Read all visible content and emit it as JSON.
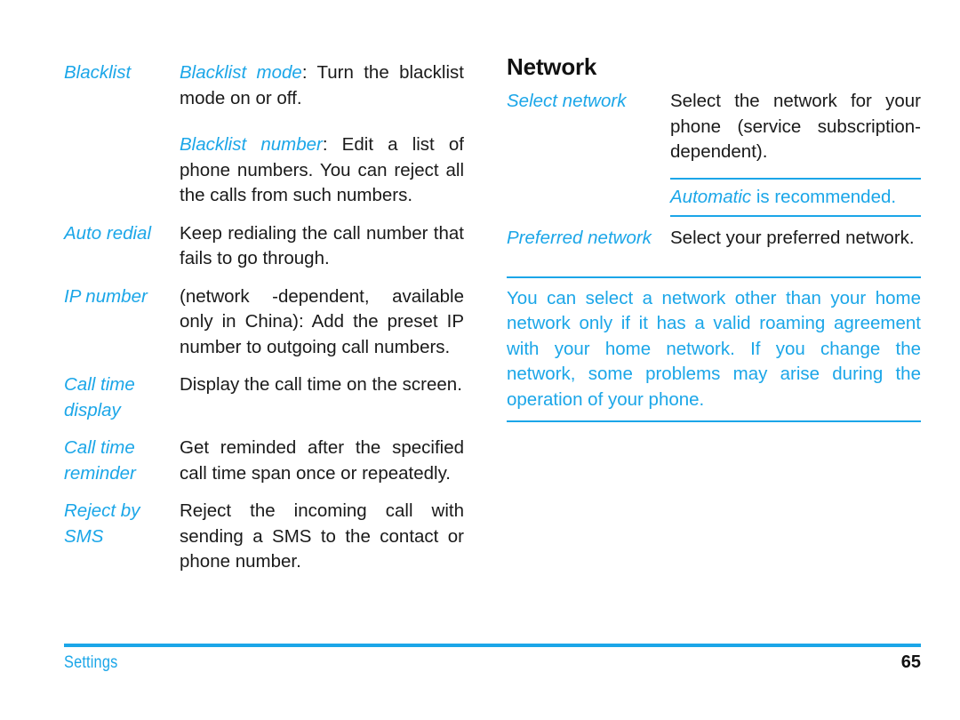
{
  "page": {
    "section_name": "Settings",
    "page_number": "65",
    "accent_color": "#1ba6e8"
  },
  "left_column": {
    "rows": [
      {
        "label": "Blacklist",
        "paragraphs": [
          {
            "term": "Blacklist mode",
            "rest": ": Turn the blacklist mode on or off."
          },
          {
            "term": "Blacklist number",
            "rest": ": Edit a list of phone numbers. You can reject all the calls from such numbers."
          }
        ]
      },
      {
        "label": "Auto redial",
        "paragraphs": [
          {
            "term": "",
            "rest": "Keep redialing the call number that fails to go through."
          }
        ]
      },
      {
        "label": "IP number",
        "paragraphs": [
          {
            "term": "",
            "rest": "(network -dependent, available only in China): Add the preset IP number to outgoing call numbers."
          }
        ]
      },
      {
        "label": "Call time display",
        "paragraphs": [
          {
            "term": "",
            "rest": "Display the call time on the screen."
          }
        ]
      },
      {
        "label": "Call time reminder",
        "paragraphs": [
          {
            "term": "",
            "rest": "Get reminded after the specified call time span once or repeatedly."
          }
        ]
      },
      {
        "label": "Reject by SMS",
        "paragraphs": [
          {
            "term": "",
            "rest": "Reject the incoming call with sending a SMS to the contact or phone number."
          }
        ]
      }
    ]
  },
  "right_column": {
    "heading": "Network",
    "rows": [
      {
        "label": "Select network",
        "paragraphs": [
          {
            "term": "",
            "rest": "Select the network for your phone (service subscription-dependent)."
          }
        ]
      }
    ],
    "note_recommended": {
      "term": "Automatic",
      "rest": " is recommended."
    },
    "rows2": [
      {
        "label": "Preferred network",
        "paragraphs": [
          {
            "term": "",
            "rest": "Select your preferred network."
          }
        ]
      }
    ],
    "note_roaming": "You can select a network other than your home network only if it has a valid roaming agreement with your home network. If you change the network, some problems may arise during the operation of your phone."
  }
}
